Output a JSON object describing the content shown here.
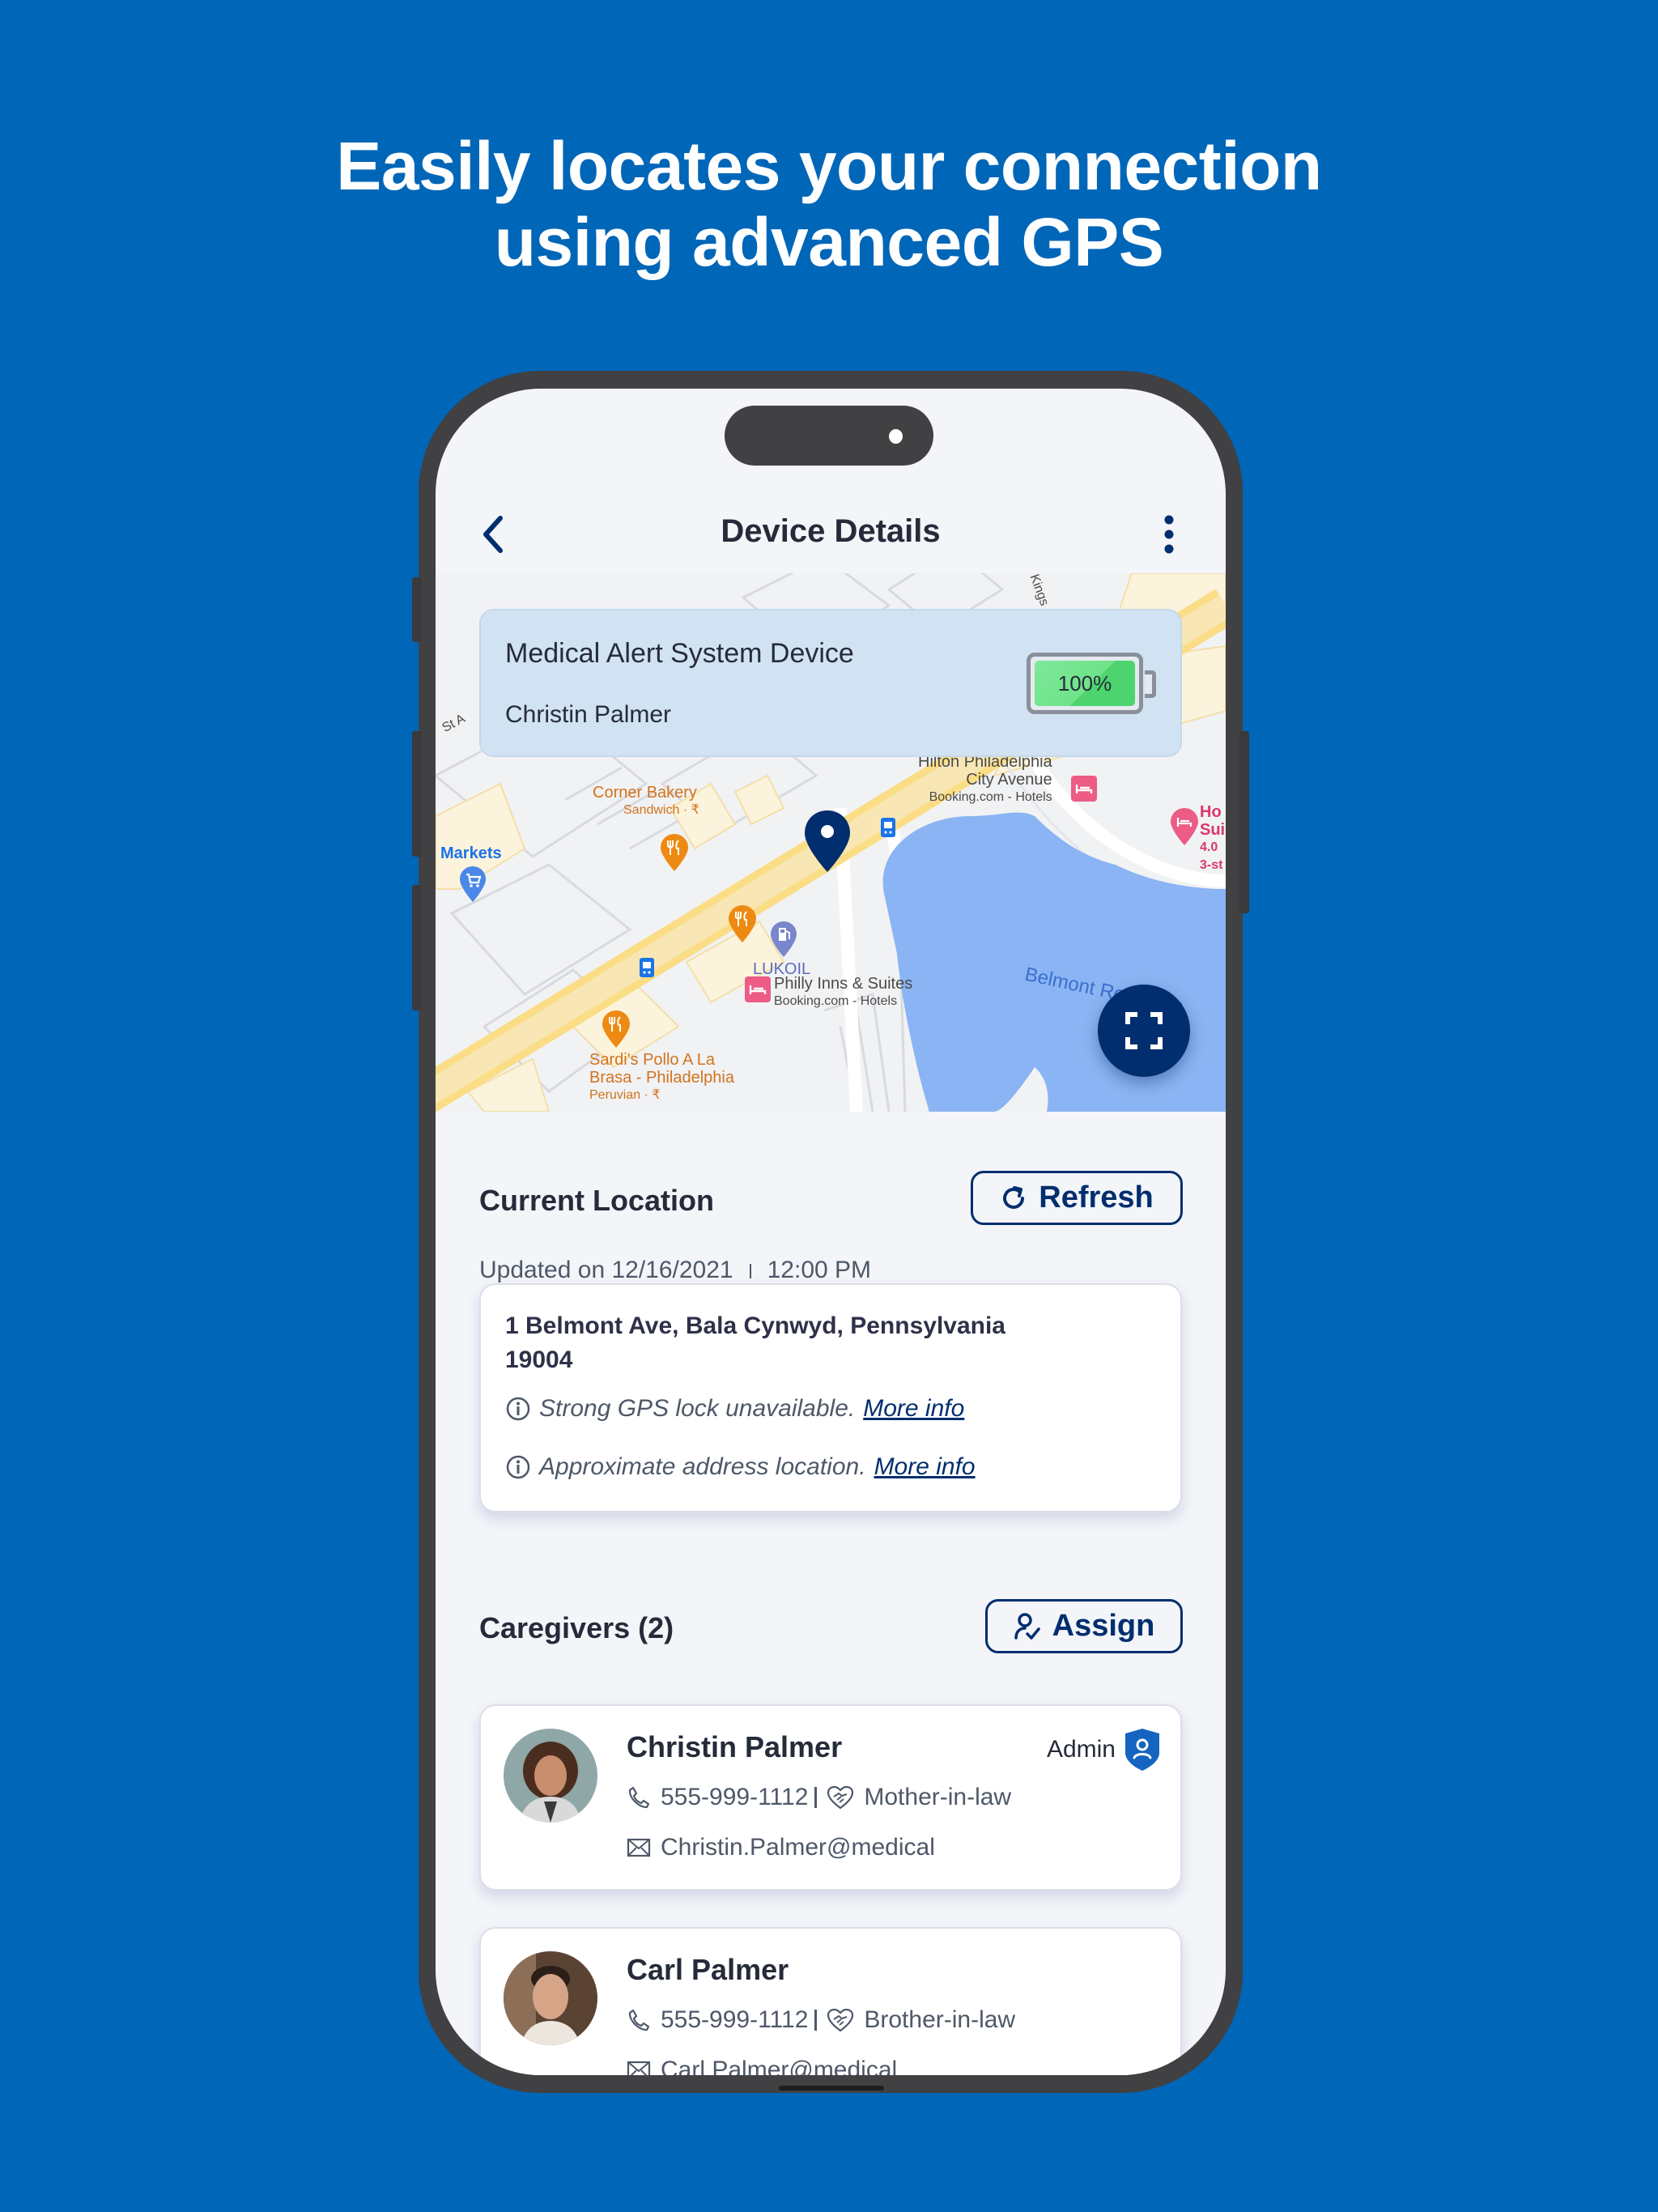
{
  "headline": {
    "line1": "Easily locates your connection",
    "line2": "using advanced GPS"
  },
  "header": {
    "title": "Device Details",
    "back_icon": "chevron-left-icon",
    "menu_icon": "more-vertical-icon"
  },
  "map": {
    "device_card": {
      "device_name": "Medical Alert System Device",
      "owner": "Christin Palmer",
      "battery_percent": 100,
      "battery_label": "100%"
    },
    "labels": {
      "markets": "Markets",
      "corner_bakery": "Corner Bakery",
      "corner_bakery_sub": "Sandwich · ₹",
      "hilton_1": "Hilton Philadelphia",
      "hilton_2": "City Avenue",
      "hilton_sub": "Booking.com - Hotels",
      "lukoil": "LUKOIL",
      "philly_inns": "Philly Inns & Suites",
      "philly_inns_sub": "Booking.com - Hotels",
      "sardis_1": "Sardi's Pollo A La",
      "sardis_2": "Brasa - Philadelphia",
      "sardis_sub": "Peruvian · ₹",
      "hotel_right_1": "Ho",
      "hotel_right_2": "Sui",
      "hotel_right_3": "4.0",
      "hotel_right_4": "3-st",
      "belmont": "Belmont Reservoir",
      "street_st": "St A",
      "street_kings": "Kings"
    },
    "fullscreen_icon": "expand-icon"
  },
  "current_location": {
    "title": "Current Location",
    "refresh_label": "Refresh",
    "updated_prefix": "Updated on 12/16/2021",
    "updated_time": "12:00 PM",
    "address": "1 Belmont Ave, Bala Cynwyd, Pennsylvania 19004",
    "notes": [
      {
        "text": "Strong GPS lock unavailable.",
        "link": "More info"
      },
      {
        "text": "Approximate address location.",
        "link": "More info"
      }
    ]
  },
  "caregivers": {
    "title": "Caregivers (2)",
    "assign_label": "Assign",
    "items": [
      {
        "name": "Christin Palmer",
        "role": "Admin",
        "phone": "555-999-1112",
        "relation": "Mother-in-law",
        "email": "Christin.Palmer@medical"
      },
      {
        "name": "Carl Palmer",
        "phone": "555-999-1112",
        "relation": "Brother-in-law",
        "email": "Carl.Palmer@medical"
      }
    ]
  },
  "colors": {
    "background": "#0066B8",
    "primary_dark": "#002E6E",
    "screen_bg": "#F3F5F9",
    "device_card_bg": "#D1E3F3",
    "battery_green": "#4DD46E",
    "admin_badge": "#1565C0"
  }
}
